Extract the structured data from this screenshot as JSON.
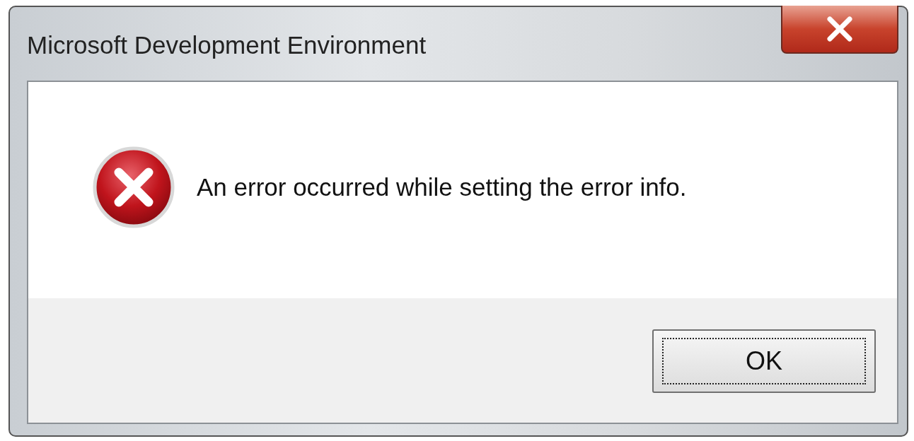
{
  "window": {
    "title": "Microsoft Development Environment"
  },
  "message": "An error occurred while setting the error info.",
  "buttons": [
    {
      "label": "OK",
      "focused": true
    }
  ]
}
